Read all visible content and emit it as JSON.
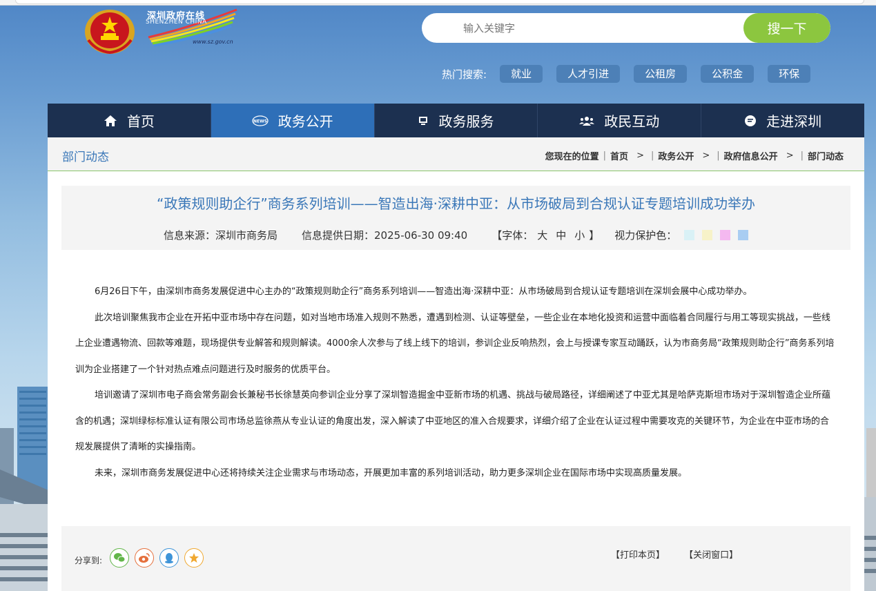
{
  "header": {
    "logo_text_cn": "深圳政府在线",
    "logo_text_en": "SHENZHEN  CHINA",
    "logo_url_text": "www.sz.gov.cn",
    "search_placeholder": "输入关键字",
    "search_button": "搜一下",
    "hot_label": "热门搜索:",
    "hot_tags": [
      "就业",
      "人才引进",
      "公租房",
      "公积金",
      "环保"
    ]
  },
  "nav": {
    "items": [
      {
        "label": "首页",
        "icon": "home-icon"
      },
      {
        "label": "政务公开",
        "icon": "news-icon",
        "active": true
      },
      {
        "label": "政务服务",
        "icon": "monitor-icon"
      },
      {
        "label": "政民互动",
        "icon": "people-icon"
      },
      {
        "label": "走进深圳",
        "icon": "chat-icon"
      }
    ]
  },
  "crumbbar": {
    "title": "部门动态",
    "location_label": "您现在的位置",
    "crumbs": [
      "首页",
      "政务公开",
      "政府信息公开",
      "部门动态"
    ]
  },
  "article": {
    "title": "“政策规则助企行”商务系列培训——智造出海·深耕中亚：从市场破局到合规认证专题培训成功举办",
    "source": "信息来源：深圳市商务局",
    "date": "信息提供日期：2025-06-30 09:40",
    "font_label_open": "【字体：",
    "font_sizes": [
      "大",
      "中",
      "小"
    ],
    "font_label_close": "】",
    "eye_label": "视力保护色：",
    "eye_colors": [
      "#d9f1f6",
      "#f7f2c8",
      "#f4b8f0",
      "#a9cdf2"
    ],
    "paragraphs": [
      "6月26日下午，由深圳市商务发展促进中心主办的“政策规则助企行”商务系列培训——智造出海·深耕中亚：从市场破局到合规认证专题培训在深圳会展中心成功举办。",
      "此次培训聚焦我市企业在开拓中亚市场中存在问题，如对当地市场准入规则不熟悉，遭遇到检测、认证等壁垒，一些企业在本地化投资和运营中面临着合同履行与用工等现实挑战，一些线上企业遭遇物流、回款等难题，现场提供专业解答和规则解读。4000余人次参与了线上线下的培训，参训企业反响热烈，会上与授课专家互动踊跃，认为市商务局“政策规则助企行”商务系列培训为企业搭建了一个针对热点难点问题进行及时服务的优质平台。",
      "培训邀请了深圳市电子商会常务副会长兼秘书长徐慧英向参训企业分享了深圳智造掘金中亚新市场的机遇、挑战与破局路径，详细阐述了中亚尤其是哈萨克斯坦市场对于深圳智造企业所蕴含的机遇；深圳绿标标准认证有限公司市场总监徐燕从专业认证的角度出发，深入解读了中亚地区的准入合规要求，详细介绍了企业在认证过程中需要攻克的关键环节，为企业在中亚市场的合规发展提供了清晰的实操指南。",
      "未来，深圳市商务发展促进中心还将持续关注企业需求与市场动态，开展更加丰富的系列培训活动，助力更多深圳企业在国际市场中实现高质量发展。"
    ]
  },
  "share": {
    "label": "分享到:",
    "icons": [
      "wechat-icon",
      "weibo-icon",
      "qq-icon",
      "favorite-icon"
    ],
    "print": "【打印本页】",
    "close": "【关闭窗口】"
  }
}
